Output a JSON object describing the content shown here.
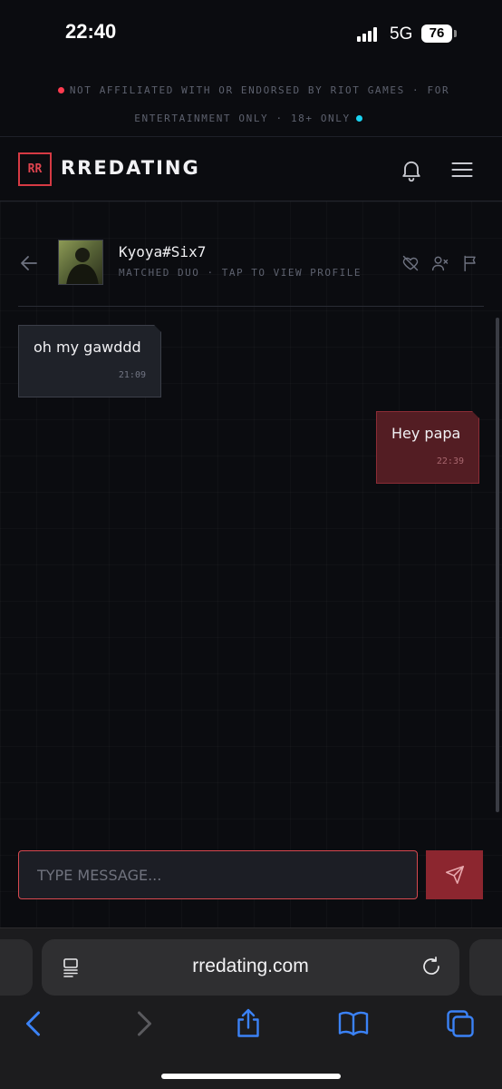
{
  "status_bar": {
    "time": "22:40",
    "network": "5G",
    "battery": "76"
  },
  "disclaimer": {
    "text": "NOT AFFILIATED WITH OR ENDORSED BY RIOT GAMES · FOR ENTERTAINMENT ONLY · 18+ ONLY"
  },
  "header": {
    "logo_mark": "RR",
    "logo_text": "RREDATING"
  },
  "chat": {
    "name": "Kyoya#Six7",
    "subtitle": "MATCHED DUO · TAP TO VIEW PROFILE",
    "messages": [
      {
        "direction": "incoming",
        "text": "oh my gawddd",
        "time": "21:09"
      },
      {
        "direction": "outgoing",
        "text": "Hey papa",
        "time": "22:39"
      }
    ]
  },
  "composer": {
    "placeholder": "TYPE MESSAGE...",
    "value": ""
  },
  "browser": {
    "url": "rredating.com"
  },
  "colors": {
    "accent": "#d7484f",
    "outgoing_bubble": "#531d23",
    "background": "#0b0c10",
    "dot_red": "#ff3b4f",
    "dot_cyan": "#19d3f1"
  },
  "icons": [
    "bell-icon",
    "menu-icon",
    "back-arrow-icon",
    "unmatch-heart-icon",
    "remove-user-icon",
    "flag-icon",
    "send-icon",
    "reader-icon",
    "reload-icon",
    "chevron-left-icon",
    "chevron-right-icon",
    "share-icon",
    "bookmarks-icon",
    "tabs-icon"
  ]
}
